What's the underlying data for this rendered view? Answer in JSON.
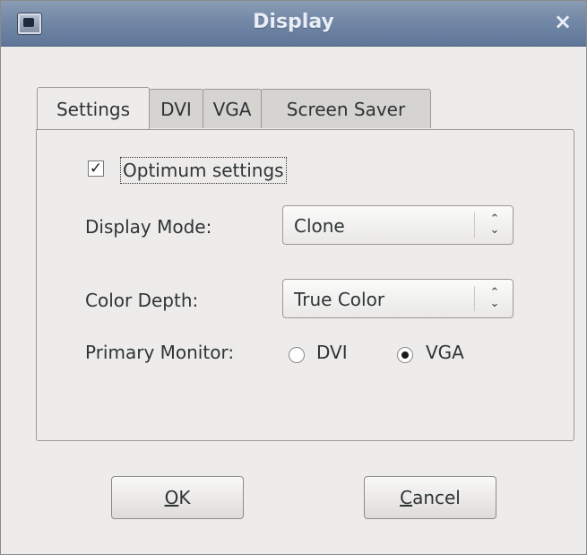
{
  "window": {
    "title": "Display",
    "close_glyph": "×",
    "icon": "display-app-icon"
  },
  "tabs": [
    {
      "label": "Settings",
      "active": true
    },
    {
      "label": "DVI",
      "active": false
    },
    {
      "label": "VGA",
      "active": false
    },
    {
      "label": "Screen Saver",
      "active": false
    }
  ],
  "settings": {
    "optimum": {
      "label": "Optimum settings",
      "checked": true,
      "check_glyph": "✓"
    },
    "display_mode": {
      "label": "Display Mode:",
      "value": "Clone"
    },
    "color_depth": {
      "label": "Color Depth:",
      "value": "True Color"
    },
    "primary_monitor": {
      "label": "Primary Monitor:",
      "options": [
        {
          "label": "DVI",
          "selected": false
        },
        {
          "label": "VGA",
          "selected": true
        }
      ]
    },
    "combo_arrow_glyph": "⌃⌄"
  },
  "buttons": {
    "ok": {
      "mnemonic": "O",
      "rest": "K"
    },
    "cancel": {
      "mnemonic": "C",
      "rest": "ancel"
    }
  }
}
